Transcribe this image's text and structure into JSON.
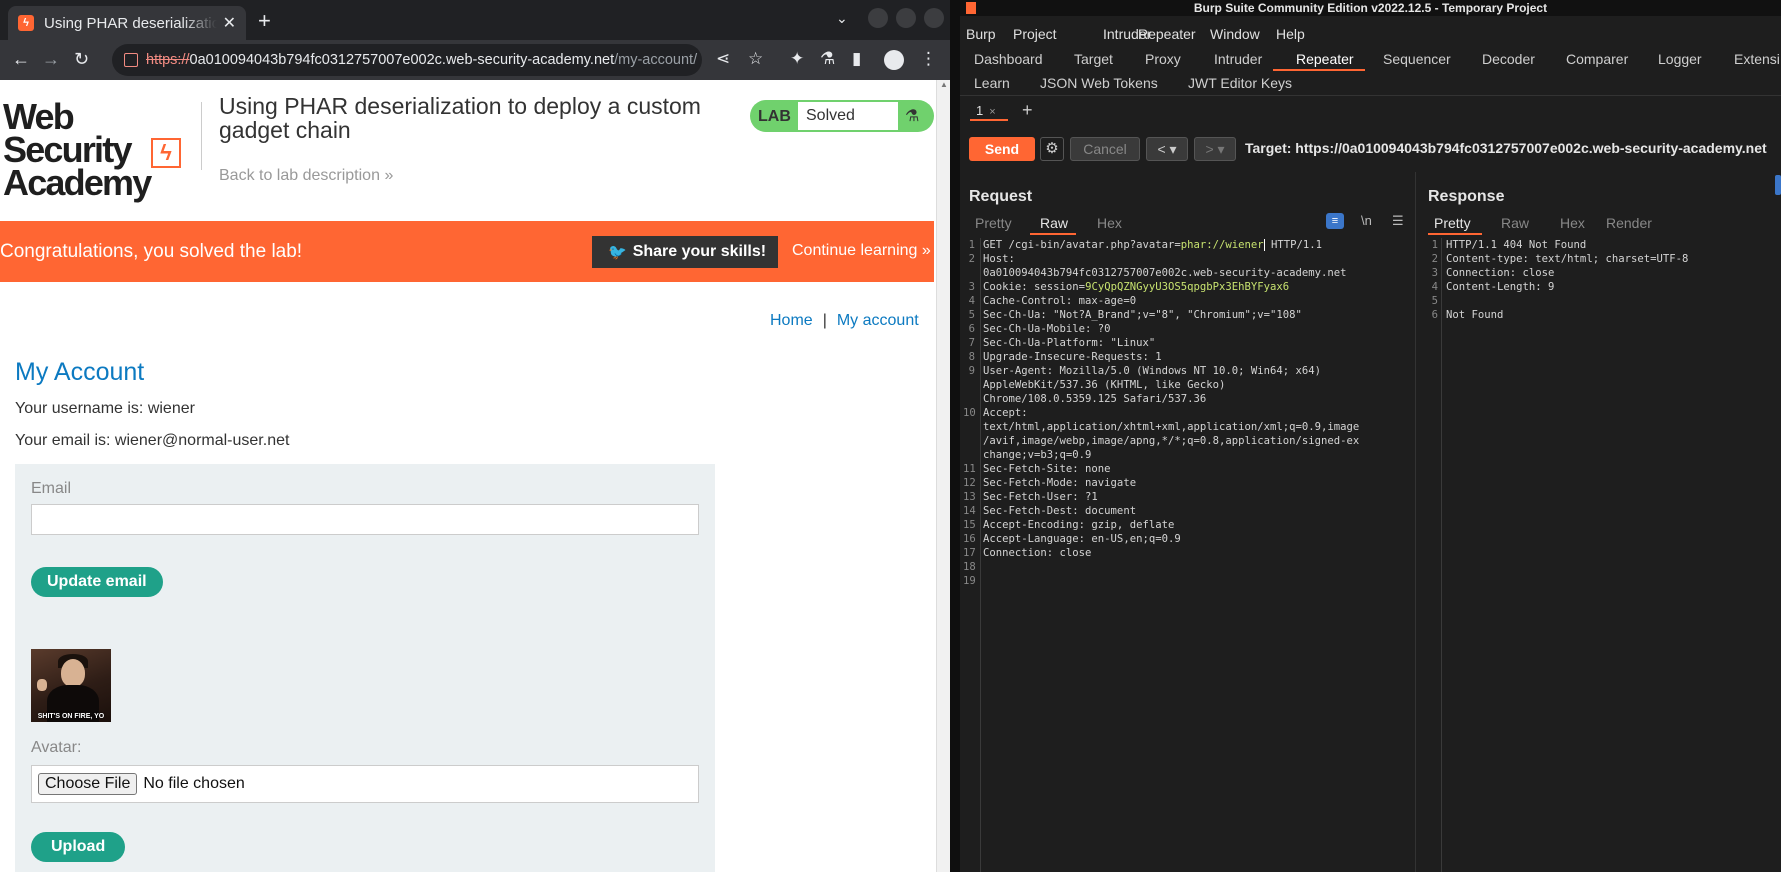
{
  "browser": {
    "tab_title": "Using PHAR deserializatio",
    "url_scheme": "https://",
    "url_host": "0a010094043b794fc0312757007e002c.web-security-academy.net",
    "url_path": "/my-account/"
  },
  "lab": {
    "logo_line1": "Web Security",
    "logo_line2": "Academy",
    "title": "Using PHAR deserialization to deploy a custom gadget chain",
    "back_link": "Back to lab description",
    "badge_label": "LAB",
    "status": "Solved"
  },
  "banner": {
    "message": "Congratulations, you solved the lab!",
    "share": "Share your skills!",
    "continue": "Continue learning"
  },
  "nav": {
    "home": "Home",
    "separator": "|",
    "account": "My account"
  },
  "account": {
    "heading": "My Account",
    "username_text": "Your username is: wiener",
    "email_text": "Your email is: wiener@normal-user.net",
    "email_label": "Email",
    "update_button": "Update email",
    "avatar_caption": "SHIT'S ON FIRE, YO",
    "avatar_label": "Avatar:",
    "file_button": "Choose File",
    "file_status": "No file chosen",
    "upload_button": "Upload"
  },
  "burp": {
    "window_title": "Burp Suite Community Edition v2022.12.5 - Temporary Project",
    "menu": [
      "Burp",
      "Project",
      "Intruder",
      "Repeater",
      "Window",
      "Help"
    ],
    "tabs_row1": [
      "Dashboard",
      "Target",
      "Proxy",
      "Intruder",
      "Repeater",
      "Sequencer",
      "Decoder",
      "Comparer",
      "Logger",
      "Extensi"
    ],
    "tabs_row2": [
      "Learn",
      "JSON Web Tokens",
      "JWT Editor Keys"
    ],
    "repeater_tab": "1",
    "send": "Send",
    "cancel": "Cancel",
    "target": "Target: https://0a010094043b794fc0312757007e002c.web-security-academy.net",
    "request_title": "Request",
    "response_title": "Response",
    "request_subtabs": [
      "Pretty",
      "Raw",
      "Hex"
    ],
    "response_subtabs": [
      "Pretty",
      "Raw",
      "Hex",
      "Render"
    ],
    "request_lines": [
      "GET /cgi-bin/avatar.php?avatar=",
      "Host:",
      "0a010094043b794fc0312757007e002c.web-security-academy.net",
      "Cookie: session=",
      "Cache-Control: max-age=0",
      "Sec-Ch-Ua: \"Not?A_Brand\";v=\"8\", \"Chromium\";v=\"108\"",
      "Sec-Ch-Ua-Mobile: ?0",
      "Sec-Ch-Ua-Platform: \"Linux\"",
      "Upgrade-Insecure-Requests: 1",
      "User-Agent: Mozilla/5.0 (Windows NT 10.0; Win64; x64)",
      "AppleWebKit/537.36 (KHTML, like Gecko)",
      "Chrome/108.0.5359.125 Safari/537.36",
      "Accept:",
      "text/html,application/xhtml+xml,application/xml;q=0.9,image",
      "/avif,image/webp,image/apng,*/*;q=0.8,application/signed-ex",
      "change;v=b3;q=0.9",
      "Sec-Fetch-Site: none",
      "Sec-Fetch-Mode: navigate",
      "Sec-Fetch-User: ?1",
      "Sec-Fetch-Dest: document",
      "Accept-Encoding: gzip, deflate",
      "Accept-Language: en-US,en;q=0.9",
      "Connection: close"
    ],
    "request_param_value": "phar://wiener",
    "request_version": " HTTP/1.1",
    "session_value": "9CyQpQZNGyyU3OS5qpgbPx3EhBYFyax6",
    "response_lines": [
      "HTTP/1.1 404 Not Found",
      "Content-type: text/html; charset=UTF-8",
      "Connection: close",
      "Content-Length: 9",
      "",
      "Not Found"
    ],
    "line_numbers": [
      "1",
      "2",
      "",
      "3",
      "4",
      "5",
      "6",
      "7",
      "8",
      "9",
      "",
      "",
      "10",
      "",
      "",
      "",
      "11",
      "12",
      "13",
      "14",
      "15",
      "16",
      "17",
      "18",
      "19"
    ]
  }
}
